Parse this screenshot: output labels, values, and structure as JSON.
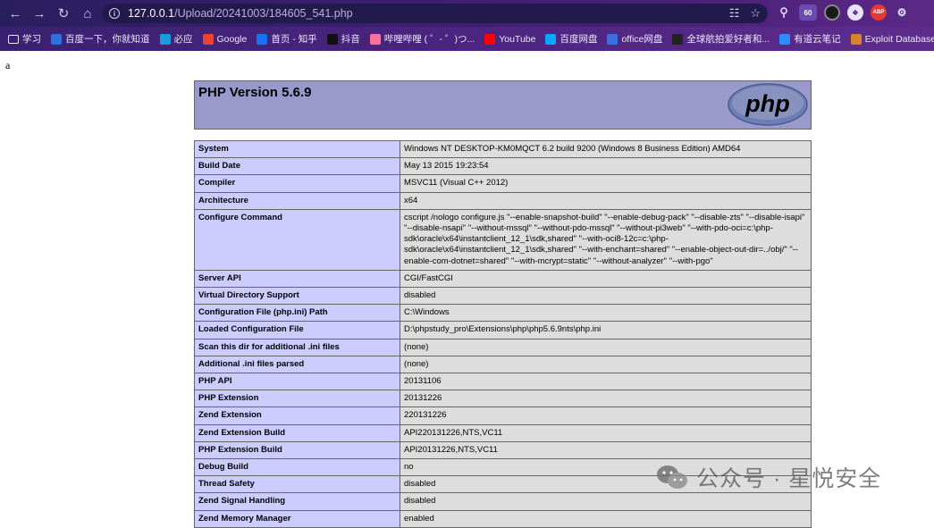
{
  "browser": {
    "url_host": "127.0.0.1",
    "url_path": "/Upload/20241003/184605_541.php",
    "ext_badge": "60",
    "ext_abp": "ABP"
  },
  "bookmarks": [
    {
      "label": "学习",
      "color": "#ffffff"
    },
    {
      "label": "百度一下，你就知道",
      "color": "#2f6fe0"
    },
    {
      "label": "必应",
      "color": "#1a9cda"
    },
    {
      "label": "Google",
      "color": "#ea4335"
    },
    {
      "label": "首页 - 知乎",
      "color": "#1772f6"
    },
    {
      "label": "抖音",
      "color": "#111111"
    },
    {
      "label": "哔哩哔哩 ( ゜- ゜)つ...",
      "color": "#fb7299"
    },
    {
      "label": "YouTube",
      "color": "#ff0000"
    },
    {
      "label": "百度网盘",
      "color": "#06a7ff"
    },
    {
      "label": "office网盘",
      "color": "#3b6fe0"
    },
    {
      "label": "全球航拍爱好者和...",
      "color": "#222222"
    },
    {
      "label": "有道云笔记",
      "color": "#2f8cff"
    },
    {
      "label": "Exploit Database -...",
      "color": "#d9822b"
    }
  ],
  "page": {
    "stray_text": "a",
    "php_title": "PHP Version 5.6.9",
    "logo_text": "php",
    "rows": [
      {
        "key": "System",
        "value": "Windows NT DESKTOP-KM0MQCT 6.2 build 9200 (Windows 8 Business Edition) AMD64"
      },
      {
        "key": "Build Date",
        "value": "May 13 2015 19:23:54"
      },
      {
        "key": "Compiler",
        "value": "MSVC11 (Visual C++ 2012)"
      },
      {
        "key": "Architecture",
        "value": "x64"
      },
      {
        "key": "Configure Command",
        "value": "cscript /nologo configure.js \"--enable-snapshot-build\" \"--enable-debug-pack\" \"--disable-zts\" \"--disable-isapi\" \"--disable-nsapi\" \"--without-mssql\" \"--without-pdo-mssql\" \"--without-pi3web\" \"--with-pdo-oci=c:\\php-sdk\\oracle\\x64\\instantclient_12_1\\sdk,shared\" \"--with-oci8-12c=c:\\php-sdk\\oracle\\x64\\instantclient_12_1\\sdk,shared\" \"--with-enchant=shared\" \"--enable-object-out-dir=../obj/\" \"--enable-com-dotnet=shared\" \"--with-mcrypt=static\" \"--without-analyzer\" \"--with-pgo\""
      },
      {
        "key": "Server API",
        "value": "CGI/FastCGI"
      },
      {
        "key": "Virtual Directory Support",
        "value": "disabled"
      },
      {
        "key": "Configuration File (php.ini) Path",
        "value": "C:\\Windows"
      },
      {
        "key": "Loaded Configuration File",
        "value": "D:\\phpstudy_pro\\Extensions\\php\\php5.6.9nts\\php.ini"
      },
      {
        "key": "Scan this dir for additional .ini files",
        "value": "(none)"
      },
      {
        "key": "Additional .ini files parsed",
        "value": "(none)"
      },
      {
        "key": "PHP API",
        "value": "20131106"
      },
      {
        "key": "PHP Extension",
        "value": "20131226"
      },
      {
        "key": "Zend Extension",
        "value": "220131226"
      },
      {
        "key": "Zend Extension Build",
        "value": "API220131226,NTS,VC11"
      },
      {
        "key": "PHP Extension Build",
        "value": "API20131226,NTS,VC11"
      },
      {
        "key": "Debug Build",
        "value": "no"
      },
      {
        "key": "Thread Safety",
        "value": "disabled"
      },
      {
        "key": "Zend Signal Handling",
        "value": "disabled"
      },
      {
        "key": "Zend Memory Manager",
        "value": "enabled"
      }
    ]
  },
  "watermark": {
    "text": "公众号 · 星悦安全"
  }
}
